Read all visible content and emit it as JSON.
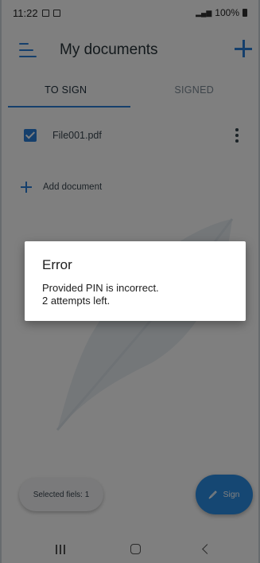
{
  "status_bar": {
    "time": "11:22",
    "battery": "100%"
  },
  "app_bar": {
    "title": "My documents"
  },
  "tabs": [
    {
      "label": "TO SIGN",
      "active": true
    },
    {
      "label": "SIGNED",
      "active": false
    }
  ],
  "documents": [
    {
      "name": "File001.pdf",
      "checked": true
    }
  ],
  "add_document": {
    "label": "Add document"
  },
  "footer": {
    "selected_label": "Selected fiels: 1",
    "sign_label": "Sign"
  },
  "dialog": {
    "title": "Error",
    "message_line1": "Provided PIN is incorrect.",
    "message_line2": "2 attempts left."
  },
  "colors": {
    "accent": "#2b7fd8",
    "fab": "#2b8fe6",
    "scrim": "rgba(0,0,0,0.5)"
  },
  "icons": [
    "menu-icon",
    "add-icon",
    "checkbox-icon",
    "more-vert-icon",
    "plus-icon",
    "pen-icon",
    "feather-watermark",
    "recents-icon",
    "home-icon",
    "back-icon"
  ]
}
